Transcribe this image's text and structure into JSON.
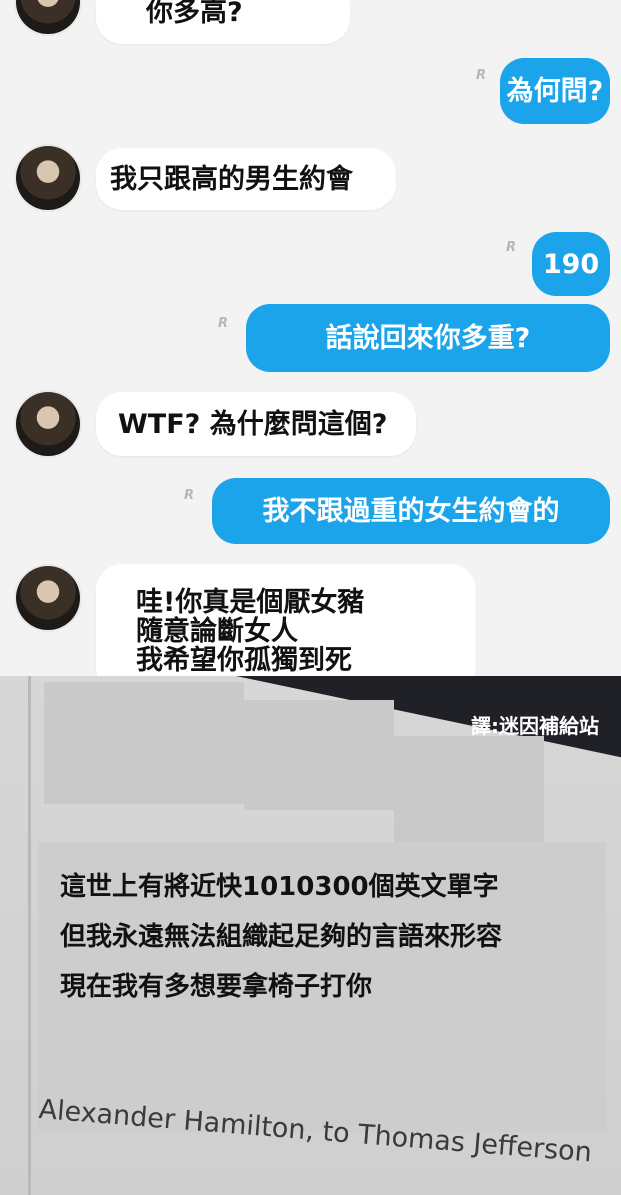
{
  "chat": {
    "messages": [
      {
        "side": "in",
        "text": "你多高?"
      },
      {
        "side": "out",
        "text": "為何問?"
      },
      {
        "side": "in",
        "text": "我只跟高的男生約會"
      },
      {
        "side": "out",
        "text": "190"
      },
      {
        "side": "out",
        "text": "話說回來你多重?"
      },
      {
        "side": "in",
        "text": "WTF? 為什麼問這個?"
      },
      {
        "side": "out",
        "text": "我不跟過重的女生約會的"
      },
      {
        "side": "in",
        "lines": [
          "哇!你真是個厭女豬",
          "隨意論斷女人",
          "我希望你孤獨到死"
        ]
      }
    ]
  },
  "meme": {
    "translator": "譯:迷因補給站",
    "lines": [
      "這世上有將近快1010300個英文單字",
      "但我永遠無法組織起足夠的言語來形容",
      "現在我有多想要拿椅子打你"
    ],
    "caption": "Alexander Hamilton, to Thomas Jefferson"
  }
}
